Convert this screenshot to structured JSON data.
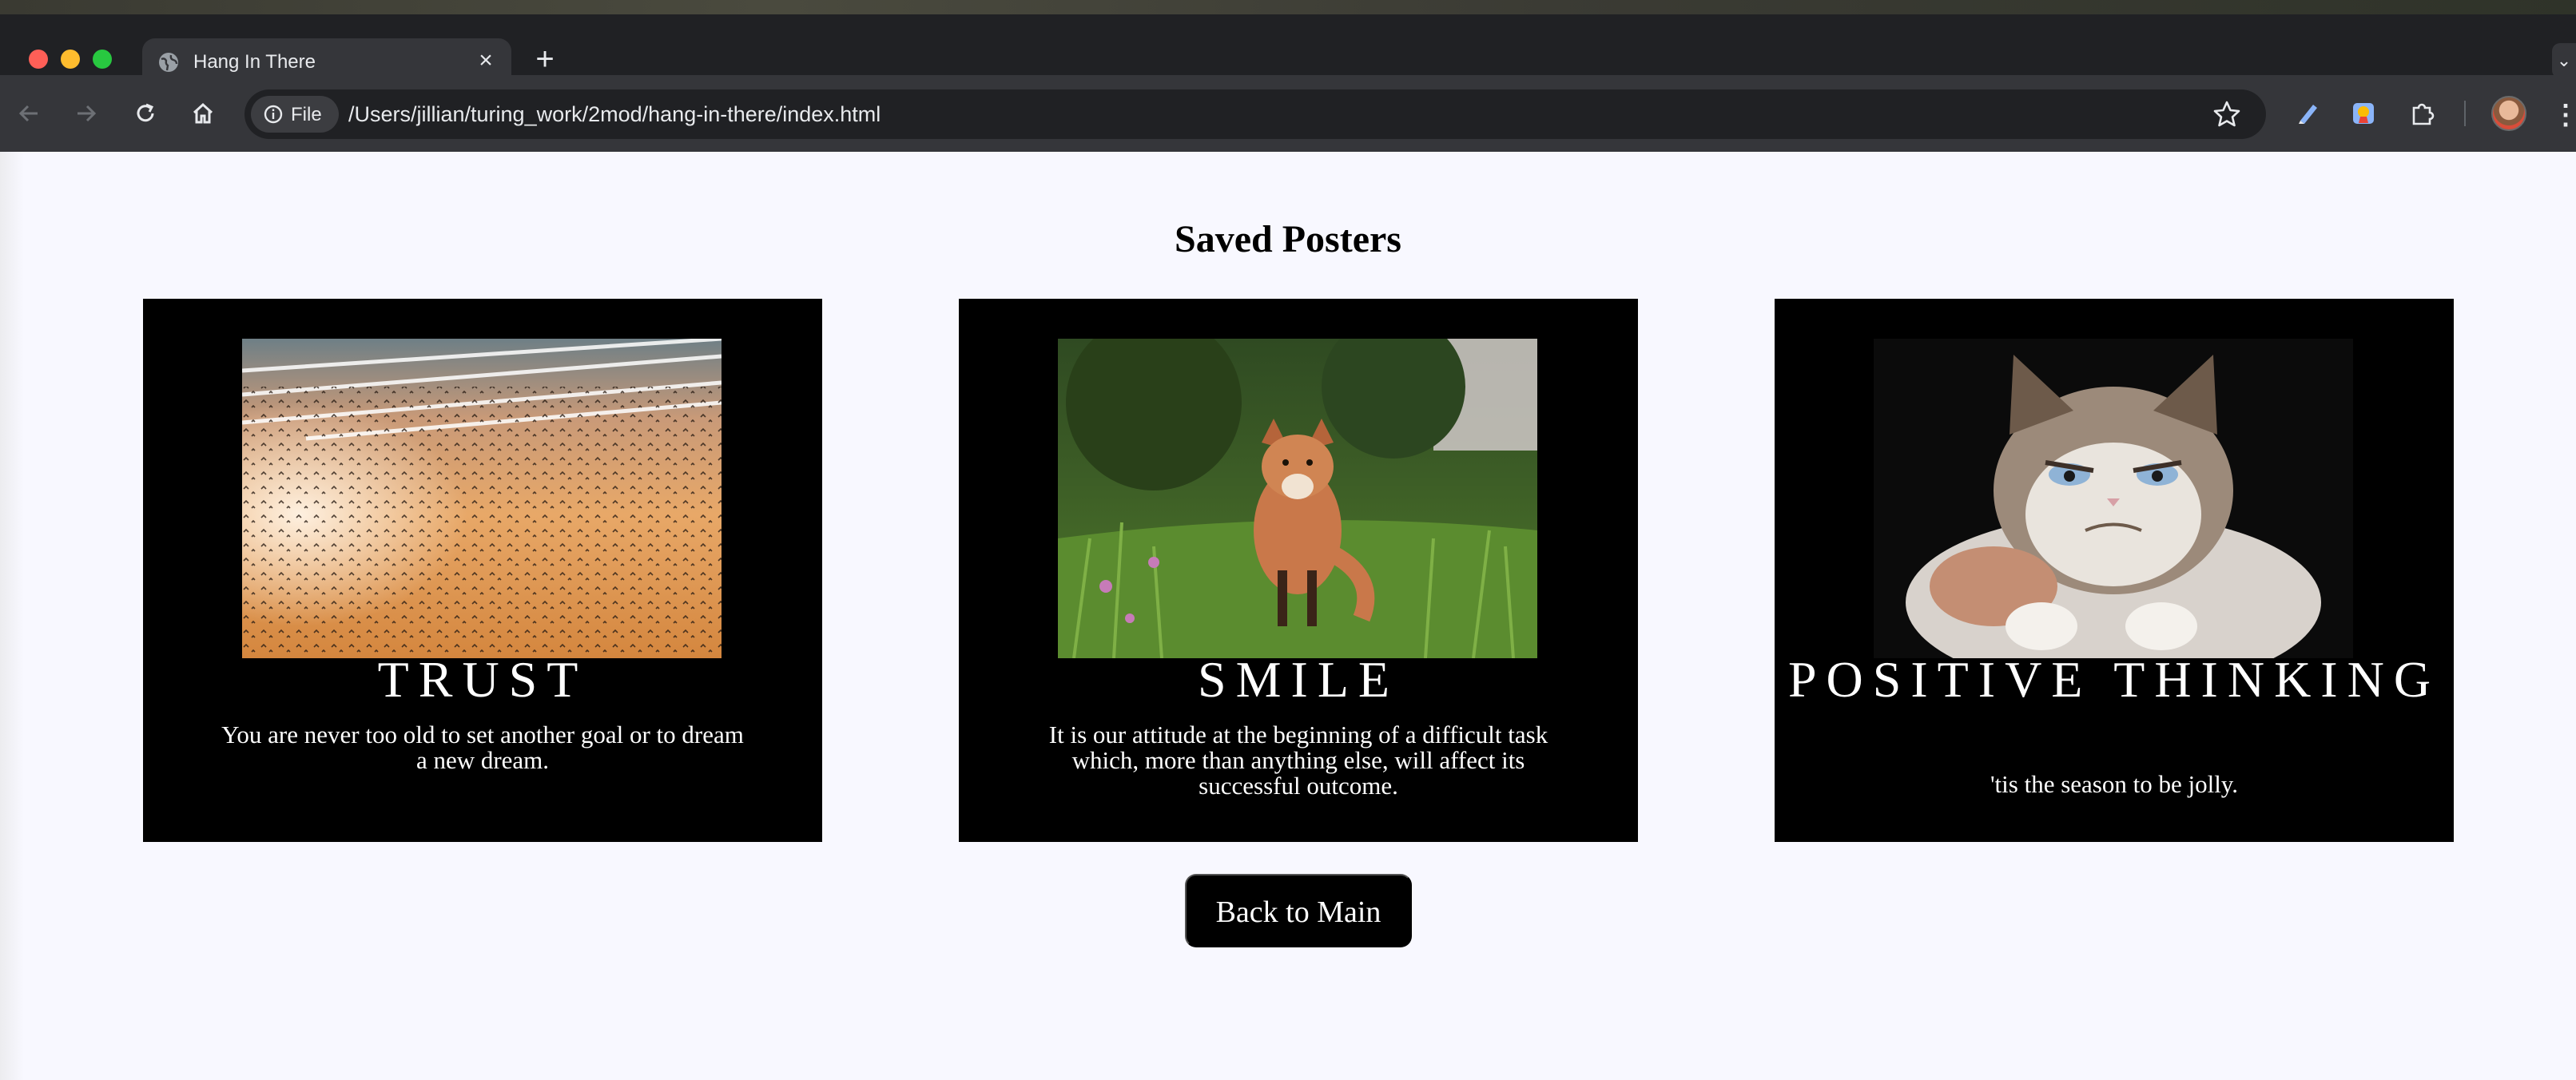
{
  "browser": {
    "tab_title": "Hang In There",
    "new_tab_label": "+",
    "close_label": "×",
    "site_chip_label": "File",
    "url": "/Users/jillian/turing_work/2mod/hang-in-there/index.html"
  },
  "page": {
    "title": "Saved Posters",
    "back_button_label": "Back to Main"
  },
  "posters": [
    {
      "title": "TRUST",
      "quote": "You are never too old to set another goal or to dream a new dream.",
      "image": "birds-flock-sunset-image"
    },
    {
      "title": "SMILE",
      "quote": "It is our attitude at the beginning of a difficult task which, more than anything else, will affect its successful outcome.",
      "image": "fox-in-grass-image"
    },
    {
      "title": "POSITIVE THINKING",
      "quote": "'tis the season to be jolly.",
      "image": "grumpy-cat-image"
    }
  ],
  "colors": {
    "page_background": "#f8f8ff",
    "poster_background": "#000000",
    "button_background": "#000000",
    "chrome_dark": "#202124",
    "chrome_toolbar": "#35363a"
  }
}
